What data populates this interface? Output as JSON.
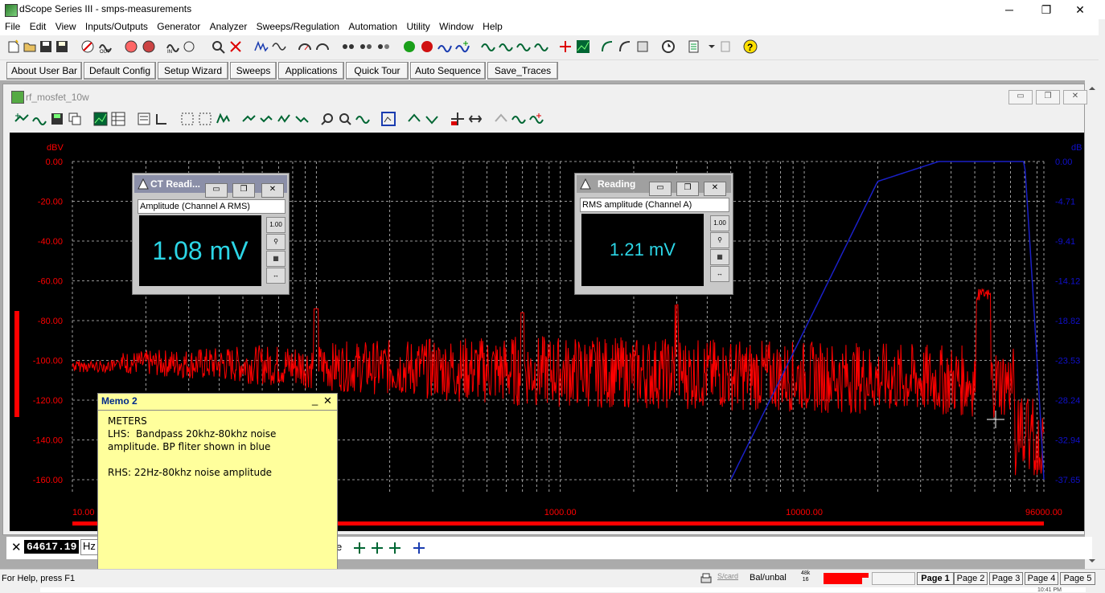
{
  "window": {
    "title": "dScope Series III - smps-measurements",
    "minimize": "─",
    "restore": "❐",
    "close": "✕"
  },
  "menu": [
    "File",
    "Edit",
    "View",
    "Inputs/Outputs",
    "Generator",
    "Analyzer",
    "Sweeps/Regulation",
    "Automation",
    "Utility",
    "Window",
    "Help"
  ],
  "user_bar": [
    "About User Bar",
    "Default Config",
    "Setup Wizard",
    "Sweeps",
    "Applications",
    "Quick Tour",
    "Auto Sequence",
    "Save_Traces"
  ],
  "child": {
    "title": "rf_mosfet_10w",
    "min": "▭",
    "restore": "❐",
    "close": "✕"
  },
  "graph": {
    "left_unit": "dBV",
    "right_unit": "dB",
    "y_labels": [
      "0.00",
      "-20.00",
      "-40.00",
      "-60.00",
      "-80.00",
      "-100.00",
      "-120.00",
      "-140.00",
      "-160.00"
    ],
    "y_right_labels": [
      "0.00",
      "-4.71",
      "-9.41",
      "-14.12",
      "-18.82",
      "-23.53",
      "-28.24",
      "-32.94",
      "-37.65"
    ],
    "x_labels": [
      "10.00",
      "1000.00",
      "10000.00",
      "96000.00"
    ],
    "grid": true,
    "left_color": "#ff0000",
    "right_color": "#1010cc"
  },
  "meter_left": {
    "title": "CT Readi...",
    "label": "Amplitude (Channel A RMS)",
    "value": "1.08 mV"
  },
  "meter_right": {
    "title": "Reading",
    "label": "RMS amplitude (Channel A)",
    "value": "1.21 mV"
  },
  "meter_buttons": [
    "1.00",
    "⚲",
    "▦",
    "↔"
  ],
  "memo": {
    "title": "Memo 2",
    "minimize": "_",
    "close": "✕",
    "text": "METERS\nLHS:  Bandpass 20khz-80khz noise\namplitude. BP fliter shown in blue\n\nRHS: 22Hz-80khz noise amplitude"
  },
  "cursor_bar": {
    "close": "✕",
    "value": "64617.19",
    "unit_partial": "Hz",
    "partial_e": "e"
  },
  "status": {
    "help": "For Help, press F1",
    "card": "S/card",
    "balance": "Bal/unbal",
    "rate_top": "48k",
    "rate_bottom": "16",
    "pages": [
      "Page 1",
      "Page 2",
      "Page 3",
      "Page 4",
      "Page 5"
    ],
    "clock_partial": "10:41 PM"
  }
}
